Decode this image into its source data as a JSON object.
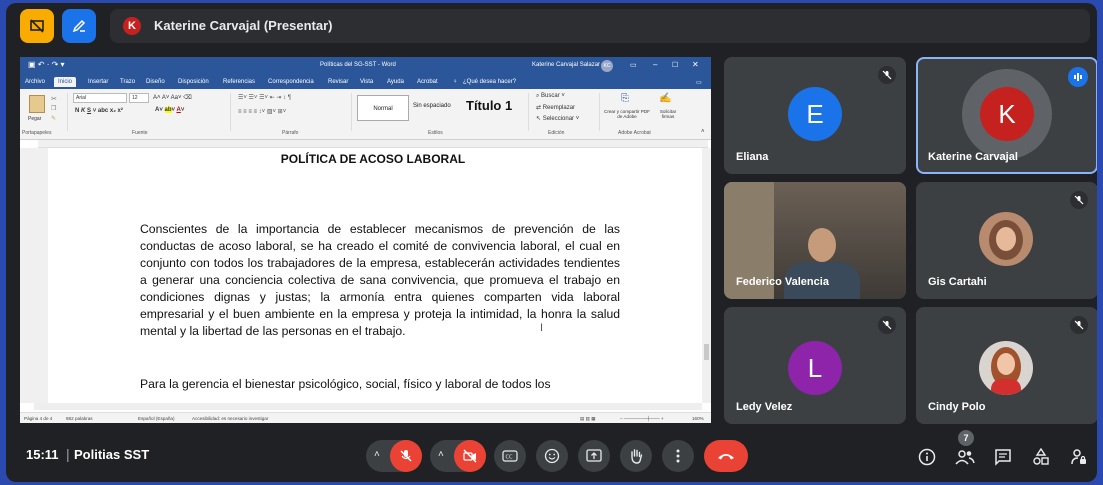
{
  "presenter_bar": {
    "avatar_letter": "K",
    "label": "Katerine Carvajal (Presentar)"
  },
  "word": {
    "doc_name": "Políticas del SG-SST - Word",
    "user": "Katerine Carvajal Salazar",
    "user_initials": "KC",
    "tabs": [
      "Archivo",
      "Inicio",
      "Insertar",
      "Trazo",
      "Diseño",
      "Disposición",
      "Referencias",
      "Correspondencia",
      "Revisar",
      "Vista",
      "Ayuda",
      "Acrobat"
    ],
    "tell_me": "¿Qué desea hacer?",
    "font": "Arial",
    "font_size": "12",
    "styles": {
      "normal": "Normal",
      "no_spacing": "Sin espaciado",
      "title1": "Título 1"
    },
    "edit_items": [
      "Buscar",
      "Reemplazar",
      "Seleccionar"
    ],
    "acrobat_items": [
      "Crear y compartir PDF de Adobe",
      "Solicitar firmas"
    ],
    "group_labels": [
      "Portapapeles",
      "Fuente",
      "Párrafo",
      "Estilos",
      "Edición",
      "Adobe Acrobat"
    ],
    "paste_label": "Pegar",
    "doc_title": "POLÍTICA DE ACOSO LABORAL",
    "para1": "Conscientes de la importancia de establecer mecanismos de prevención de las conductas de acoso laboral, se ha creado el comité de convivencia laboral, el cual en conjunto con todos los trabajadores de la empresa, establecerán actividades tendientes a generar una conciencia colectiva de sana convivencia, que promueva el trabajo en condiciones dignas y justas; la armonía entra quienes comparten vida laboral empresarial y el buen ambiente en la empresa y proteja la intimidad, la honra la salud mental y la libertad de las personas en el trabajo.",
    "para2": "Para la gerencia el bienestar psicológico, social, físico y laboral de todos los",
    "status": {
      "page": "Página 4 de 4",
      "words": "882 palabras",
      "lang": "Español (España)",
      "access": "Accesibilidad: es necesario investigar",
      "zoom": "160%"
    }
  },
  "participants": [
    {
      "name": "Eliana",
      "initial": "E",
      "color": "#1a73e8",
      "muted": true
    },
    {
      "name": "Katerine Carvajal",
      "initial": "K",
      "color": "#c5221f",
      "speaking": true
    },
    {
      "name": "Federico Valencia",
      "video": true
    },
    {
      "name": "Gis Cartahi",
      "photo": true,
      "muted": true
    },
    {
      "name": "Ledy Velez",
      "initial": "L",
      "color": "#8e24aa",
      "muted": true
    },
    {
      "name": "Cindy Polo",
      "photo": true,
      "muted": true
    }
  ],
  "bottom": {
    "time": "15:11",
    "separator": "|",
    "meeting": "Politias SST",
    "people_count": "7"
  }
}
